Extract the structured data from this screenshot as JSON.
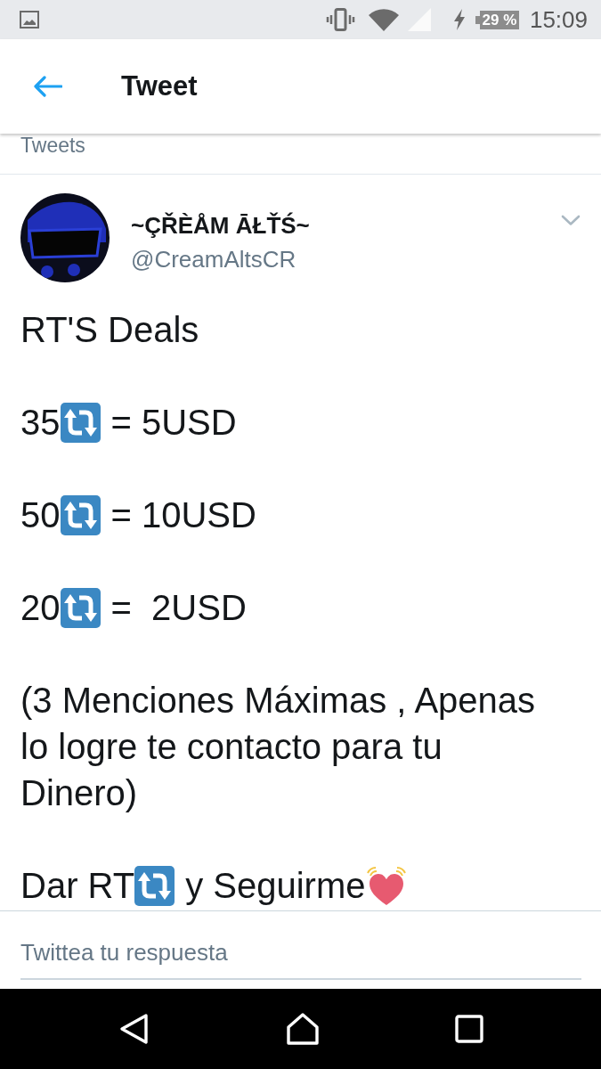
{
  "status_bar": {
    "battery": "29 %",
    "time": "15:09"
  },
  "app_bar": {
    "title": "Tweet"
  },
  "section_label": "Tweets",
  "tweet": {
    "author": {
      "name": "~ÇŘÈÅM ĀŁŤŚ~",
      "handle": "@CreamAltsCR"
    },
    "paragraphs": [
      [
        {
          "kind": "text",
          "text": "RT'S Deals"
        }
      ],
      [
        {
          "kind": "text",
          "text": "35"
        },
        {
          "kind": "repeat"
        },
        {
          "kind": "text",
          "text": "= 5USD"
        }
      ],
      [
        {
          "kind": "text",
          "text": "50"
        },
        {
          "kind": "repeat"
        },
        {
          "kind": "text",
          "text": "= 10USD"
        }
      ],
      [
        {
          "kind": "text",
          "text": "20"
        },
        {
          "kind": "repeat"
        },
        {
          "kind": "text",
          "text": "=  2USD"
        }
      ],
      [
        {
          "kind": "text",
          "text": "(3 Menciones Máximas , Apenas lo logre te contacto para tu Dinero)"
        }
      ],
      [
        {
          "kind": "text",
          "text": "Dar RT"
        },
        {
          "kind": "repeat"
        },
        {
          "kind": "text",
          "text": "y Seguirme"
        },
        {
          "kind": "heart"
        }
      ]
    ]
  },
  "reply": {
    "placeholder": "Twittea tu respuesta"
  }
}
